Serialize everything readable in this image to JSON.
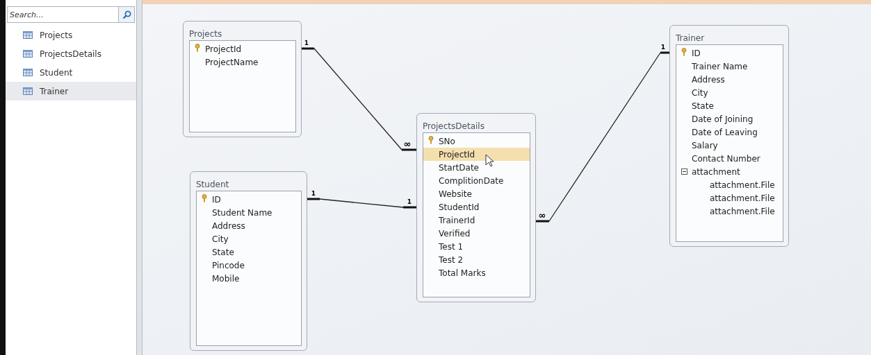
{
  "sidebar": {
    "search": {
      "placeholder": "Search..."
    },
    "items": [
      {
        "label": "Projects",
        "selected": false
      },
      {
        "label": "ProjectsDetails",
        "selected": false
      },
      {
        "label": "Student",
        "selected": false
      },
      {
        "label": "Trainer",
        "selected": true
      }
    ]
  },
  "tables": [
    {
      "title": "Projects",
      "fields": [
        {
          "name": "ProjectId",
          "primary_key": true,
          "selected": false
        },
        {
          "name": "ProjectName",
          "primary_key": false,
          "selected": false
        }
      ]
    },
    {
      "title": "ProjectsDetails",
      "fields": [
        {
          "name": "SNo",
          "primary_key": true,
          "selected": false
        },
        {
          "name": "ProjectId",
          "primary_key": false,
          "selected": true
        },
        {
          "name": "StartDate",
          "primary_key": false,
          "selected": false
        },
        {
          "name": "ComplitionDate",
          "primary_key": false,
          "selected": false
        },
        {
          "name": "Website",
          "primary_key": false,
          "selected": false
        },
        {
          "name": "StudentId",
          "primary_key": false,
          "selected": false
        },
        {
          "name": "TrainerId",
          "primary_key": false,
          "selected": false
        },
        {
          "name": "Verified",
          "primary_key": false,
          "selected": false
        },
        {
          "name": "Test 1",
          "primary_key": false,
          "selected": false
        },
        {
          "name": "Test 2",
          "primary_key": false,
          "selected": false
        },
        {
          "name": "Total Marks",
          "primary_key": false,
          "selected": false
        }
      ]
    },
    {
      "title": "Student",
      "fields": [
        {
          "name": "ID",
          "primary_key": true,
          "selected": false
        },
        {
          "name": "Student Name",
          "primary_key": false,
          "selected": false
        },
        {
          "name": "Address",
          "primary_key": false,
          "selected": false
        },
        {
          "name": "City",
          "primary_key": false,
          "selected": false
        },
        {
          "name": "State",
          "primary_key": false,
          "selected": false
        },
        {
          "name": "Pincode",
          "primary_key": false,
          "selected": false
        },
        {
          "name": "Mobile",
          "primary_key": false,
          "selected": false
        }
      ]
    },
    {
      "title": "Trainer",
      "fields": [
        {
          "name": "ID",
          "primary_key": true,
          "selected": false
        },
        {
          "name": "Trainer Name",
          "primary_key": false,
          "selected": false
        },
        {
          "name": "Address",
          "primary_key": false,
          "selected": false
        },
        {
          "name": "City",
          "primary_key": false,
          "selected": false
        },
        {
          "name": "State",
          "primary_key": false,
          "selected": false
        },
        {
          "name": "Date of Joining",
          "primary_key": false,
          "selected": false
        },
        {
          "name": "Date of Leaving",
          "primary_key": false,
          "selected": false
        },
        {
          "name": "Salary",
          "primary_key": false,
          "selected": false
        },
        {
          "name": "Contact Number",
          "primary_key": false,
          "selected": false
        },
        {
          "name": "attachment",
          "primary_key": false,
          "selected": false,
          "expanded": true,
          "children": [
            {
              "name": "attachment.File",
              "primary_key": false,
              "selected": false
            },
            {
              "name": "attachment.File",
              "primary_key": false,
              "selected": false
            },
            {
              "name": "attachment.File",
              "primary_key": false,
              "selected": false
            }
          ]
        }
      ]
    }
  ],
  "relationships": [
    {
      "from_label": "1",
      "to_label": "∞"
    },
    {
      "from_label": "1",
      "to_label": "1"
    },
    {
      "from_label": "∞",
      "to_label": "1"
    }
  ]
}
